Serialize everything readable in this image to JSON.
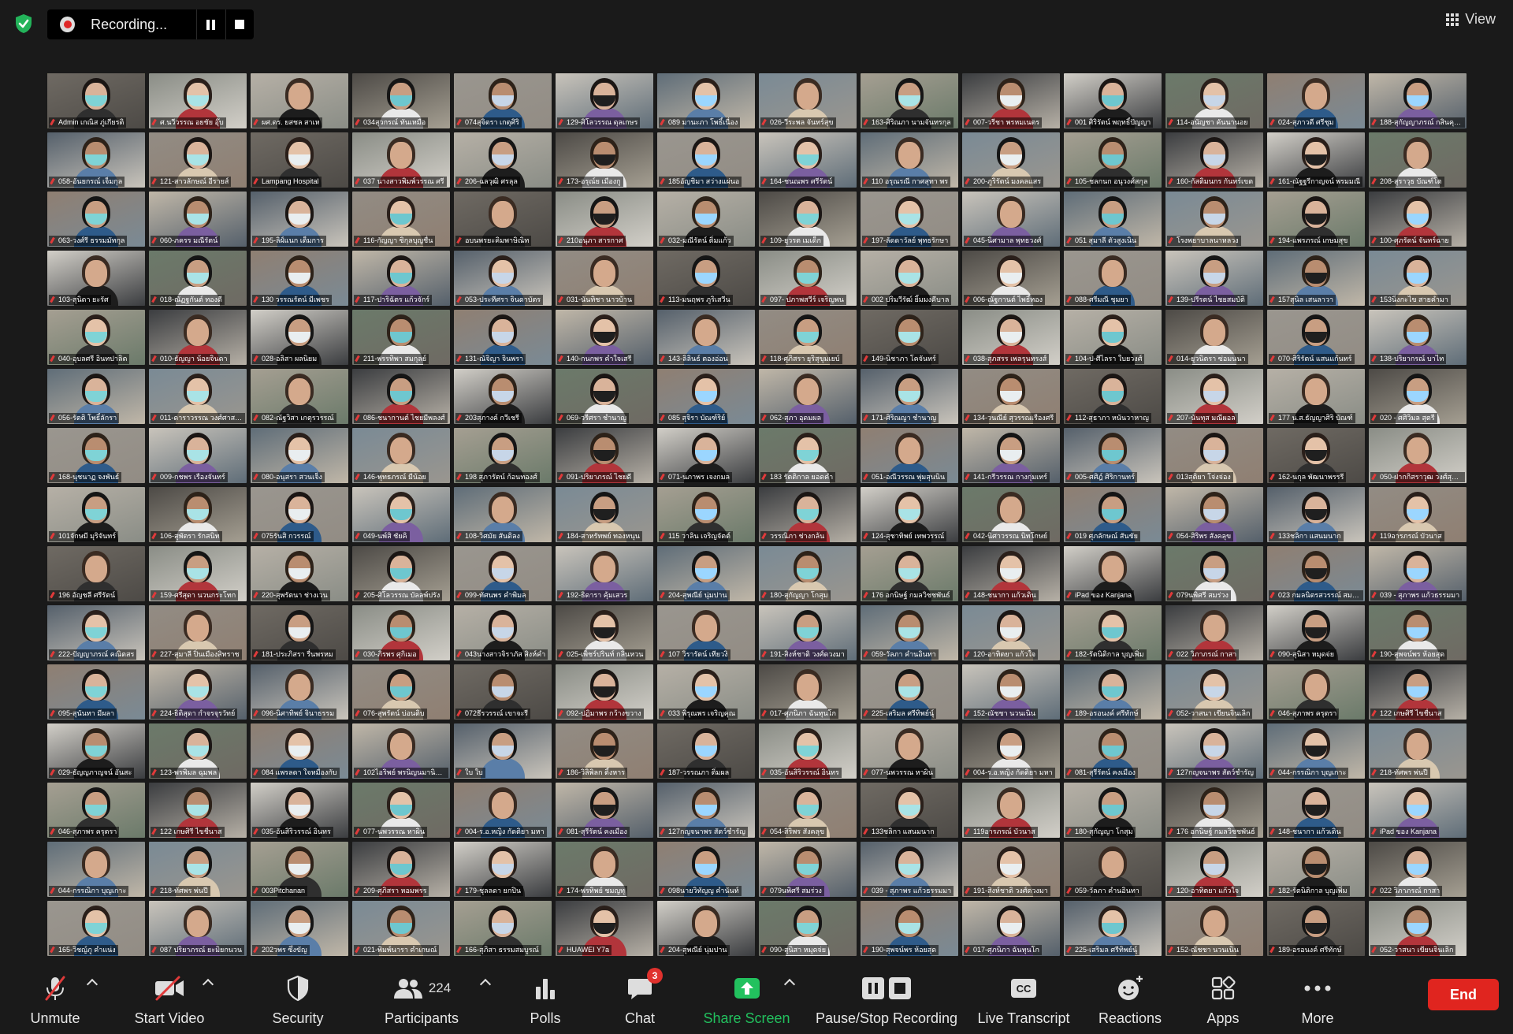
{
  "recording": {
    "label": "Recording..."
  },
  "view": {
    "label": "View"
  },
  "participants": [
    "Admin เกณิส ภู่เกียรติ",
    "ศ.นวีวรรณ อยชัย อุ๊บ",
    "ผศ.ดร. ยสชล สาเห",
    "034สุวกรณ์ ทันเหมือ",
    "074สุจิตรา เกตุศิริ",
    "129-ศิโลวรรณ ดุลเกษร",
    "089 มานะภา โพธิ์เนื่อง",
    "026-วีระพล จันทร์สุข",
    "163-ศิริณภา นามจันทรกุล",
    "007-วรีชา พรหมเนตร",
    "001 ศิริรัตน์ พฤทธิ์ปัญญา",
    "114-อนัญชา คันนานอย",
    "024-สุภาวดี ศรีชุม",
    "188-สุกัญญาภรณ์ กสินคุณธ์",
    "058-อันยกรณ์ เจ็มกุล",
    "121-สาวลักษณ์ อีรายส์",
    "Lampang Hospital",
    "037 นางสาวพิมพ์วรรณ ศรี",
    "206-ฉลวุฒิ ศรลุล",
    "173-อรุณ์ย เมืองกู",
    "185อัญชิมา สว่างแผ่นอ",
    "164-ชนณพร ศรีรัตน์",
    "110 อรุณรณี กาศสุทา พร",
    "200-ภูริรัตน์ มงคลแสร",
    "105-ชลกนก อนุวงศ์สกุล",
    "160-กัสติมนกร กันทร์เขต",
    "161-ณัฐฐรีกาญจน์ พรมมณี",
    "208-สุราวุธ บัณฑ์โต",
    "063-วงศ์รี ธรรมมัทกุล",
    "060-ภครร มณีรัตน์",
    "195-ลิฝ์แนก เต็มการ",
    "116-กัญญา ซิกุลบุญชื่น",
    "อบนพรยะคิมพาษิณิท",
    "210อนุภา สารกาศ",
    "032-มณีรัตน์ ติ่มแก้ว",
    "109-ยุวรต เมเด็ก",
    "197-ลัดดาวัลย์ พุทธรักษา",
    "045-นิศามาล พุทธวงศ์",
    "051 สุมาลี ตัวสูงเนิน",
    "โรงพยาบาลนาหลวง",
    "194-แพรภรณ์ เกษมสุข",
    "100-ศุภรัตน์ จันทร์ฉาย",
    "103-สุนิดา ยะรัศ",
    "018-ณัฏฐกันต์ ทองดี",
    "130 วรรณรัตน์ มีเพชร",
    "117-ปาริฉัตร แก้วจักร์",
    "053-ประทีศรา จินดาบัตร",
    "031-นันทิชา นาวบ้าน",
    "113-มนฤพร ภูริเสวีน",
    "097- ปภาพสวีร์ เจริญพน",
    "002 ปริมวีรัฒ์ ยิ้มมงคีบาล",
    "006-ณัฐกานต์ ไพธิ์ทอง",
    "088-ศรีมณี ชุมยา",
    "139-ปรีรตน์ ไชยสมบัติ",
    "157สุนิล เสนลาวา",
    "153นิ่งกะไข สายคำมา",
    "040-อุบลศรี อินทปาลิต",
    "010-ธัญญา น้อยจินดา",
    "028-อลิสา ผลนิยม",
    "211-พรรทิพา สมกุลย์",
    "131-ณัจิญา จินพรา",
    "140-กนกพร คำใจเสรี",
    "143-ลิลินธ์ ตองอ่อน",
    "118-ศุภิสรา ยุริสุขุมเยบ์",
    "149-นิชาภา โคจันทร์",
    "038-สุภสรร เพลรุนทรงส์",
    "104-ป-ศีไลรา ใบยวงศ์",
    "014-ยุวนิตรา ซ่อมนนา",
    "070-ศิริรัตน์ แสนแก้นทร์",
    "138-ปริยากรณ์ บาไท",
    "056-รัตติ โพธิ์ลักรา",
    "011-ดาราวรรณ วงศ์ศาสตร์",
    "082-ณัฐวิสา เกตุรวรรณ์",
    "086-ชนากานต์ ไชยมีพลงศ์",
    "203สุภางค์ กวีเชรี",
    "069-วรีศรา ชำนาญ",
    "085 สุจิรา บัณฑ์ริย์",
    "062-สุภา อุดมผล",
    "171-ศิริณญา ชำนาญ",
    "134-วนณีย์ สุวรรณเรืองศรี",
    "112-สุธาภา หนันวาหาญ",
    "207-นันทุส มณีผอล",
    "177 น.ส.ธัญญาศิริ บัณฑ์",
    "020 - ศศิวิมล สุตรี",
    "168-นุชนาฏ จงพันธ์",
    "009-กชพร เรืองจันทร์",
    "080-อนุสรา สวนเจ็ง",
    "146-พุทธภรณ์ มีน้อย",
    "198 สุภารัตน์ ก้อนทองศ์",
    "091-ปริยาภรณ์ ไชยดี",
    "071-นภาพร เจงกมล",
    "183 รัตติกาล ยอดคำ",
    "051-อณีวรรณ พุ่มสุนนิน",
    "141-กรีวรรณ กางกุ่มเทร์",
    "005-ศศิฎ์ ศิริกานทร์",
    "013สุติยา โจ่งจ่อง",
    "162-นกุล พัฒนาพรรรี",
    "050-ฝากกิสราวุฒ วงศ์สุวรร",
    "101จักษมี มุริจันทร์",
    "106-สุพัตรา รักสนิท",
    "075รันสิ กวรรณ์",
    "049-นพ์สิ ชัยคิ",
    "108-วิศมัย สันดิลง",
    "184-สาหรัทพย์ ทองหนุน",
    "115 วาลิน เจริญจัตต์",
    "วรรณิภา ช่างกล้น",
    "124-สุชาทิพย์ เทพวรรณ์",
    "042-นิศาวรรณ นิทโกษย์",
    "019 ศุภลักษณ์ สันชัย",
    "054-สิริพร สังคลุข",
    "133ชลิกา แสนมนาก",
    "119อารภรณ์ บัวนาส",
    "196 อัญชลี ศรีรัตน์",
    "159-ศรีสุดา นวนกระโทก",
    "220-สุพรัตนา ช่างเวน",
    "205-ศิโลวรรณ บัลลพ์ปรัง",
    "099-ทัศนพร คำพิมล",
    "192-ธิดารา คุ้มเสวร",
    "204-สุพณีย์ นุ่มปาน",
    "180-สุกัญญา โกสุม",
    "176 อกนิษฐ์ กมลวิชชพันธ์",
    "148-ชนากา แก้วเดิน",
    "iPad ของ Kanjana",
    "079นพิศรี สมร่วง",
    "023 กมลนิตรสวรรณ์ สมโนทัย",
    "039 - สุภาพร แก้วธรรมมา",
    "222-ปัญญาภรณ์ คณิตสร",
    "227-สุมาลี ปิ่นเมืองสิทราช",
    "181-ประภิสรา รื่นพรหม",
    "030-ภิรพร ศุกิเมอ",
    "043นางสาวจิราภัส สิงห์คำ",
    "025-เพ็ชร์ปรินท์ กลิ่นหวน",
    "107 วิรารัตน์ เทียวงิ",
    "191-สิงห์ชาติ วงศ์ดวงมา",
    "059-วัลภา คำนอินทา",
    "120-อาทิตยา แก้วใจ",
    "182-รัตนิติกาล บุญเพิ่ม",
    "022 วิภาภรณ์ กาสา",
    "090-สุนิสา หมุดจ่ย",
    "190-สุพจน์พร ห้อยสุด",
    "095-สุนันทา มีผลา",
    "224-ธิติสุดา กำจรจุรวัทย์",
    "096-นิศาทิพย์ จินาธรรม",
    "076-สุพรัตน์ บ่อนติบ",
    "072ธีรวรรณ์ เขาจะรี",
    "092-ปฏิมาพร กว้างขวาง",
    "033 พิรุณพร เจริญคุณ",
    "017-ศุภนิภา ฉันทุนโก",
    "225-เสริมล ศรีทิพย์นุ์",
    "152-ณัชชา นวนเนิน",
    "189-อรอนงค์ ศรีทักษ์",
    "052-วาสนา เขียนจินเลิก",
    "046-สุภาพร ครุตรา",
    "122 เกษศิรี ไขชื่นาส",
    "029-ธัญญภาญจน์ อันสะ",
    "123-พรพิมล ฉุมพล",
    "084 แพรลดา ใจหมื่องกับ",
    "102ไอริพย์ พรนิญนมานิรภัพ",
    "ใบ ใบ",
    "186-วิลิพิลก ติ้งหาร",
    "187-วรรณภา ติ่มผล",
    "035-อันสิริวรรณ์ อินทร",
    "077-นพวรรณ หาผิน",
    "004-ร.อ.หญิง กัดติยา มหา",
    "081-สุรีรัตน์ คงเมือง",
    "127กญจนาพร สัตว์ชำรัญ",
    "044-กรรณิกา บุญเกาะ",
    "218-ทัศพร พ่นปี",
    "046-สุภาพร ครุตรา",
    "122 เกษศิรี ไขชื่นาส",
    "035-อันสิริวรรณ์ อินทร",
    "077-นพวรรณ หาผิน",
    "004-ร.อ.หญิง กัดติยา มหา",
    "081-สุรีรัตน์ คงเมือง",
    "127กญจนาพร สัตว์ชำรัญ",
    "054-สิริพร สังคลุข",
    "133ชลิกา แสนมนาก",
    "119อารภรณ์ บัวนาส",
    "180-สุกัญญา โกสุม",
    "176 อกนิษฐ์ กมลวิชชพันธ์",
    "148-ชนากา แก้วเดิน",
    "iPad ของ Kanjana",
    "044-กรรณิกา บุญเกาะ",
    "218-ทัศพร พ่นปี",
    "003Pitchanan",
    "209-ศุภิสรา หอมพรร",
    "179-ชุลลดา ยกปิน",
    "174-พรทิพย์ ชมญทุ",
    "098นายวิทัญญ คำนันท์",
    "079นพิศรี สมร่วง",
    "039 - สุภาพร แก้วธรรมมา",
    "191-สิงห์ชาติ วงศ์ดวงมา",
    "059-วัลภา คำนอินทา",
    "120-อาทิตยา แก้วใจ",
    "182-รัตนิติกาล บุญเพิ่ม",
    "022 วิภาภรณ์ กาสา",
    "165-วิชญ์ภู คำแน่ง",
    "087 ปริยาภรณ์ ยะมิยกนวน",
    "202วพร ซึ่งขัญ",
    "021-พิมพ์นารา คำเกษณ์",
    "166-สุภิสา ธรรมสมบูรณ์",
    "HUAWEI Y7a",
    "204-สุพณีย์ นุ่มปาน",
    "090-สุนิสา หมุดจ่ย",
    "190-สุพจน์พร ห้อยสุด",
    "017-ศุภนิภา ฉันทุนโก",
    "225-เสริมล ศรีทิพย์นุ์",
    "152-ณัชชา นวนเนิน",
    "189-อรอนงค์ ศรีทักษ์",
    "052-วาสนา เขียนจินเลิก"
  ],
  "toolbar": {
    "unmute": "Unmute",
    "start_video": "Start Video",
    "security": "Security",
    "participants": "Participants",
    "participants_count": "224",
    "polls": "Polls",
    "chat": "Chat",
    "chat_badge": "3",
    "share_screen": "Share Screen",
    "pause_stop_recording": "Pause/Stop Recording",
    "live_transcript": "Live Transcript",
    "reactions": "Reactions",
    "apps": "Apps",
    "more": "More",
    "end": "End"
  },
  "colors": {
    "accent_green": "#22c15e",
    "end_red": "#e0251f",
    "active_speaker": "#b5d62c",
    "muted_red": "#e03a3a"
  }
}
